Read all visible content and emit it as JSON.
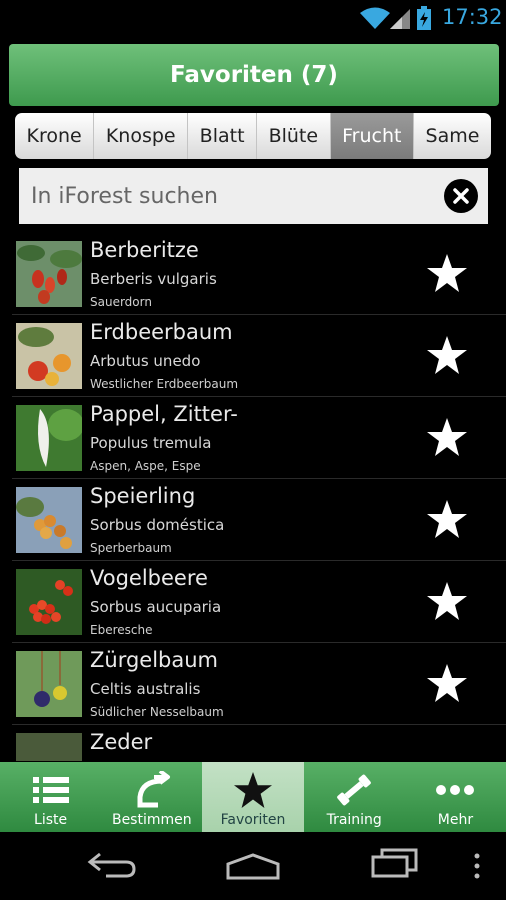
{
  "status": {
    "time": "17:32"
  },
  "header": {
    "title": "Favoriten (7)"
  },
  "tabs": [
    {
      "label": "Krone",
      "active": false
    },
    {
      "label": "Knospe",
      "active": false
    },
    {
      "label": "Blatt",
      "active": false
    },
    {
      "label": "Blüte",
      "active": false
    },
    {
      "label": "Frucht",
      "active": true
    },
    {
      "label": "Same",
      "active": false
    }
  ],
  "search": {
    "placeholder": "In iForest suchen"
  },
  "items": [
    {
      "name": "Berberitze",
      "latin": "Berberis vulgaris",
      "common": "Sauerdorn"
    },
    {
      "name": "Erdbeerbaum",
      "latin": "Arbutus unedo",
      "common": "Westlicher Erdbeerbaum"
    },
    {
      "name": "Pappel, Zitter-",
      "latin": "Populus tremula",
      "common": "Aspen, Aspe, Espe"
    },
    {
      "name": "Speierling",
      "latin": "Sorbus doméstica",
      "common": "Sperberbaum"
    },
    {
      "name": "Vogelbeere",
      "latin": "Sorbus aucuparia",
      "common": "Eberesche"
    },
    {
      "name": "Zürgelbaum",
      "latin": "Celtis australis",
      "common": "Südlicher Nesselbaum"
    },
    {
      "name": "Zeder",
      "latin": "",
      "common": ""
    }
  ],
  "bottom_nav": [
    {
      "label": "Liste",
      "icon": "list-icon"
    },
    {
      "label": "Bestimmen",
      "icon": "rotate-arrow-icon"
    },
    {
      "label": "Favoriten",
      "icon": "star-icon",
      "active": true
    },
    {
      "label": "Training",
      "icon": "dumbbell-icon"
    },
    {
      "label": "Mehr",
      "icon": "more-dots-icon"
    }
  ],
  "colors": {
    "accent_green": "#3e9a4e",
    "status_blue": "#39a8e0"
  }
}
